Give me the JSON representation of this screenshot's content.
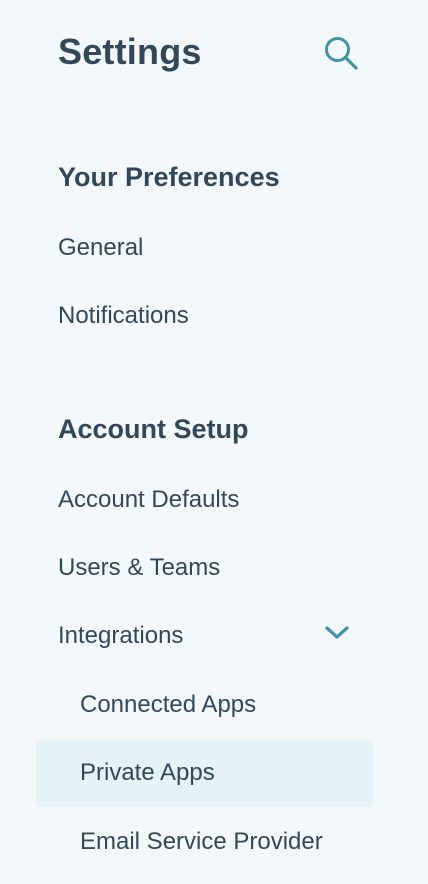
{
  "header": {
    "title": "Settings",
    "search_icon": "search-icon"
  },
  "sections": [
    {
      "heading": "Your Preferences",
      "items": [
        {
          "label": "General"
        },
        {
          "label": "Notifications"
        }
      ]
    },
    {
      "heading": "Account Setup",
      "items": [
        {
          "label": "Account Defaults"
        },
        {
          "label": "Users & Teams"
        },
        {
          "label": "Integrations",
          "expanded": true,
          "icon": "chevron-down-icon",
          "children": [
            {
              "label": "Connected Apps",
              "active": false
            },
            {
              "label": "Private Apps",
              "active": true
            },
            {
              "label": "Email Service Provider",
              "active": false
            }
          ]
        }
      ]
    }
  ],
  "colors": {
    "background": "#f5f8fa",
    "text": "#33475b",
    "accent": "#0091ae",
    "active_background": "#e5f3f8"
  }
}
